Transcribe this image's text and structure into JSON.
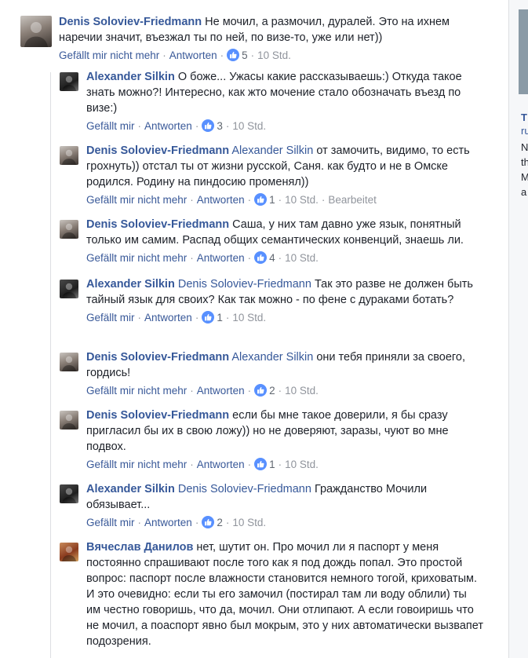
{
  "colors": {
    "link": "#365899",
    "meta": "#606770",
    "like": "#5890ff"
  },
  "side": {
    "lines": [
      "T",
      "ru",
      "N",
      "th",
      "M",
      "a"
    ]
  },
  "comments": [
    {
      "author": "Denis Soloviev-Friedmann",
      "avatar": "denis",
      "tag": "",
      "text": "Не мочил, а размочил, дуралей. Это на ихнем наречии значит, въезжал ты по ней, по визе-то, уже или нет))",
      "like_label": "Gefällt mir nicht mehr",
      "reply_label": "Antworten",
      "likes": "5",
      "time": "10 Std.",
      "edited": ""
    },
    {
      "author": "Alexander Silkin",
      "avatar": "alex",
      "tag": "",
      "text": "О боже... Ужасы какие рассказываешь:) Откуда такое знать можно?! Интересно, как жто мочение стало обозначать въезд по визе:)",
      "like_label": "Gefällt mir",
      "reply_label": "Antworten",
      "likes": "3",
      "time": "10 Std.",
      "edited": ""
    },
    {
      "author": "Denis Soloviev-Friedmann",
      "avatar": "denis",
      "tag": "Alexander Silkin",
      "text": "от замочить, видимо, то есть грохнуть)) отстал ты от жизни русской, Саня. как будто и не в Омске родился. Родину на пиндосию променял))",
      "like_label": "Gefällt mir nicht mehr",
      "reply_label": "Antworten",
      "likes": "1",
      "time": "10 Std.",
      "edited": "Bearbeitet"
    },
    {
      "author": "Denis Soloviev-Friedmann",
      "avatar": "denis",
      "tag": "",
      "text": "Саша, у них там давно уже язык, понятный только им самим. Распад общих семантических конвенций, знаешь ли.",
      "like_label": "Gefällt mir nicht mehr",
      "reply_label": "Antworten",
      "likes": "4",
      "time": "10 Std.",
      "edited": ""
    },
    {
      "author": "Alexander Silkin",
      "avatar": "alex",
      "tag": "Denis Soloviev-Friedmann",
      "text": "Так это разве не должен быть тайный язык для своих? Как так можно - по фене с дураками ботать?",
      "like_label": "Gefällt mir",
      "reply_label": "Antworten",
      "likes": "1",
      "time": "10 Std.",
      "edited": ""
    },
    {
      "author": "Denis Soloviev-Friedmann",
      "avatar": "denis",
      "tag": "Alexander Silkin",
      "text": "они тебя приняли за своего, гордись!",
      "like_label": "Gefällt mir nicht mehr",
      "reply_label": "Antworten",
      "likes": "2",
      "time": "10 Std.",
      "edited": ""
    },
    {
      "author": "Denis Soloviev-Friedmann",
      "avatar": "denis",
      "tag": "",
      "text": "если бы мне такое доверили, я бы сразу пригласил бы их в свою ложу)) но не доверяют, заразы, чуют во мне подвох.",
      "like_label": "Gefällt mir nicht mehr",
      "reply_label": "Antworten",
      "likes": "1",
      "time": "10 Std.",
      "edited": ""
    },
    {
      "author": "Alexander Silkin",
      "avatar": "alex",
      "tag": "Denis Soloviev-Friedmann",
      "text": "Гражданство Мочили обязывает...",
      "like_label": "Gefällt mir",
      "reply_label": "Antworten",
      "likes": "2",
      "time": "10 Std.",
      "edited": ""
    },
    {
      "author": "Вячеслав Данилов",
      "avatar": "vyach",
      "tag": "",
      "text": "нет, шутит он. Про мочил ли я паспорт у меня постоянно спрашивают после того как я под дождь попал. Это простой вопрос: паспорт после влажности становится немного тогой, криховатым. И это очевидно: если ты его замочил (постирал там ли воду облили) ты им честно говоришь, что да, мочил. Они отлипают. А если говоиришь что не мочил, а поаспорт явно был мокрым, это у них автоматически вызвапет подозрения.",
      "like_label": "",
      "reply_label": "",
      "likes": "",
      "time": "",
      "edited": ""
    }
  ]
}
